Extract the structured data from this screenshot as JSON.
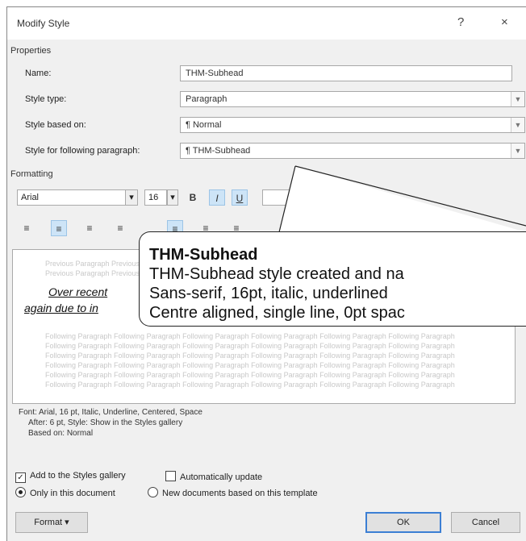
{
  "dialog": {
    "title": "Modify Style",
    "help_glyph": "?",
    "close_glyph": "×"
  },
  "properties": {
    "heading": "Properties",
    "name_label": "Name:",
    "name_value": "THM-Subhead",
    "style_type_label": "Style type:",
    "style_type_value": "Paragraph",
    "based_on_label": "Style based on:",
    "based_on_value": "¶ Normal",
    "following_label": "Style for following paragraph:",
    "following_value": "¶ THM-Subhead"
  },
  "formatting": {
    "heading": "Formatting",
    "font": "Arial",
    "size": "16",
    "bold": "B",
    "italic": "I",
    "underline": "U"
  },
  "preview": {
    "sample_line1": "Over recent",
    "sample_line2": "again due to in",
    "faint_prev": "Previous Paragraph Previous Paragraph Previous Paragraph Previous Paragraph",
    "faint_next": "Following Paragraph Following Paragraph Following Paragraph Following Paragraph Following Paragraph Following Paragraph"
  },
  "description": {
    "line1": "Font: Arial, 16 pt, Italic, Underline, Centered, Space",
    "line2": "After:  6 pt, Style: Show in the Styles gallery",
    "line3": "Based on: Normal"
  },
  "options": {
    "add_gallery": "Add to the Styles gallery",
    "add_gallery_checked": true,
    "auto_update": "Automatically update",
    "auto_update_checked": false,
    "only_doc": "Only in this document",
    "new_docs": "New documents based on this template"
  },
  "buttons": {
    "format": "Format ▾",
    "ok": "OK",
    "cancel": "Cancel"
  },
  "callout": {
    "title": "THM-Subhead",
    "line1": "THM-Subhead style created and na",
    "line2": "Sans-serif, 16pt, italic, underlined",
    "line3": "Centre aligned, single line, 0pt spac"
  },
  "colors": {
    "dialog_bg": "#f0f0f0",
    "accent": "#3c7fd4",
    "selected_toolbar": "#cde4f7"
  }
}
